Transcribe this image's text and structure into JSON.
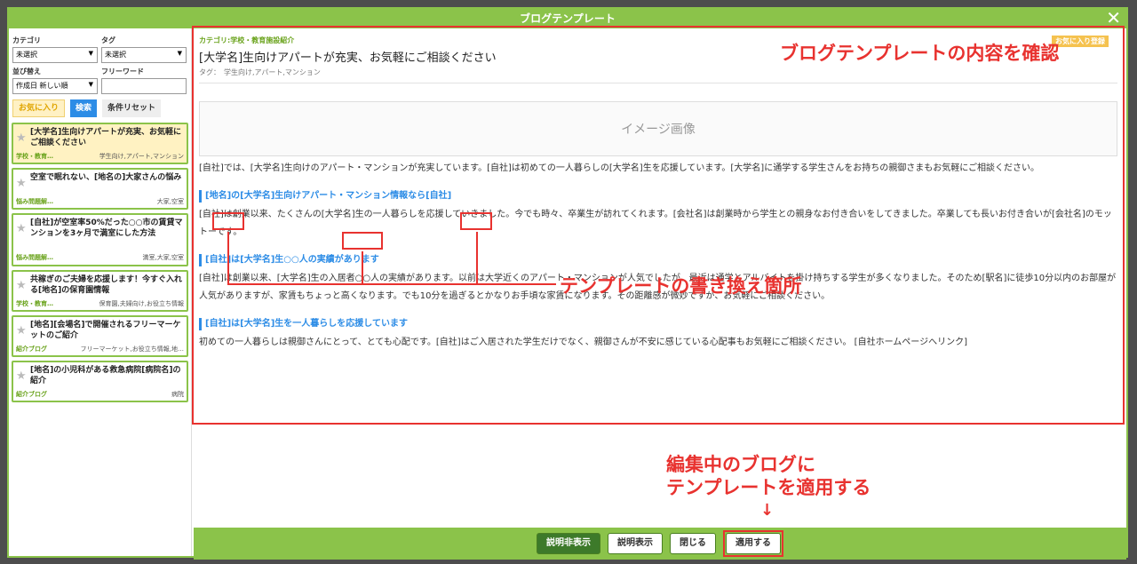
{
  "window": {
    "title": "ブログテンプレート"
  },
  "filters": {
    "category_label": "カテゴリ",
    "category_value": "未選択",
    "tag_label": "タグ",
    "tag_value": "未選択",
    "sort_label": "並び替え",
    "sort_value": "作成日 新しい順",
    "keyword_label": "フリーワード",
    "keyword_value": "",
    "fav_button": "お気に入り",
    "search_button": "検索",
    "reset_button": "条件リセット"
  },
  "list": [
    {
      "title": "[大学名]生向けアパートが充実、お気軽にご相談ください",
      "category": "学校・教育…",
      "tags": "学生向け,アパート,マンション",
      "active": true
    },
    {
      "title": "空室で眠れない、[地名の]大家さんの悩み",
      "category": "悩み問題解…",
      "tags": "大家,空室",
      "active": false
    },
    {
      "title": "[自社]が空室率50%だった○○市の賃貸マンションを3ヶ月で満室にした方法",
      "category": "悩み問題解…",
      "tags": "満室,大家,空室",
      "active": false
    },
    {
      "title": "共稼ぎのご夫婦を応援します！今すぐ入れる[地名]の保育園情報",
      "category": "学校・教育…",
      "tags": "保育園,夫婦向け,お役立ち情報",
      "active": false
    },
    {
      "title": "[地名][会場名]で開催されるフリーマーケットのご紹介",
      "category": "紹介ブログ",
      "tags": "フリーマーケット,お役立ち情報,地…",
      "active": false
    },
    {
      "title": "[地名]の小児科がある救急病院[病院名]の紹介",
      "category": "紹介ブログ",
      "tags": "病院",
      "active": false
    }
  ],
  "preview": {
    "category": "カテゴリ:学校・教育施設紹介",
    "title": "[大学名]生向けアパートが充実、お気軽にご相談ください",
    "tags": "タグ：　学生向け,アパート,マンション",
    "fav_badge": "お気に入り登録",
    "image_placeholder": "イメージ画像",
    "intro": "[自社]では、[大学名]生向けのアパート・マンションが充実しています。[自社]は初めての一人暮らしの[大学名]生を応援しています。[大学名]に通学する学生さんをお持ちの親御さまもお気軽にご相談ください。",
    "s1_head": "[地名]の[大学名]生向けアパート・マンション情報なら[自社]",
    "s1_body": "[自社]は創業以来、たくさんの[大学名]生の一人暮らしを応援していきました。今でも時々、卒業生が訪れてくれます。[会社名]は創業時から学生との親身なお付き合いをしてきました。卒業しても長いお付き合いが[会社名]のモットーです。",
    "s2_head": "[自社]は[大学名]生○○人の実績があります",
    "s2_body": "[自社]は創業以来、[大学名]生の入居者○○人の実績があります。以前は大学近くのアパート・マンションが人気でしたが、最近は通学とアルバイトを掛け持ちする学生が多くなりました。そのため[駅名]に徒歩10分以内のお部屋が人気がありますが、家賃もちょっと高くなります。でも10分を過ぎるとかなりお手頃な家賃になります。その距離感が微妙ですが、お気軽にご相談ください。",
    "s3_head": "[自社]は[大学名]生を一人暮らしを応援しています",
    "s3_body": "初めての一人暮らしは親御さんにとって、とても心配です。[自社]はご入居された学生だけでなく、親御さんが不安に感じている心配事もお気軽にご相談ください。 [自社ホームページへリンク]"
  },
  "annotations": {
    "confirm": "ブログテンプレートの内容を確認",
    "rewrite": "テンプレートの書き換え箇所",
    "apply_1": "編集中のブログに",
    "apply_2": "テンプレートを適用する",
    "arrow": "↓"
  },
  "footer": {
    "hide_desc": "説明非表示",
    "show_desc": "説明表示",
    "close": "閉じる",
    "apply": "適用する"
  }
}
